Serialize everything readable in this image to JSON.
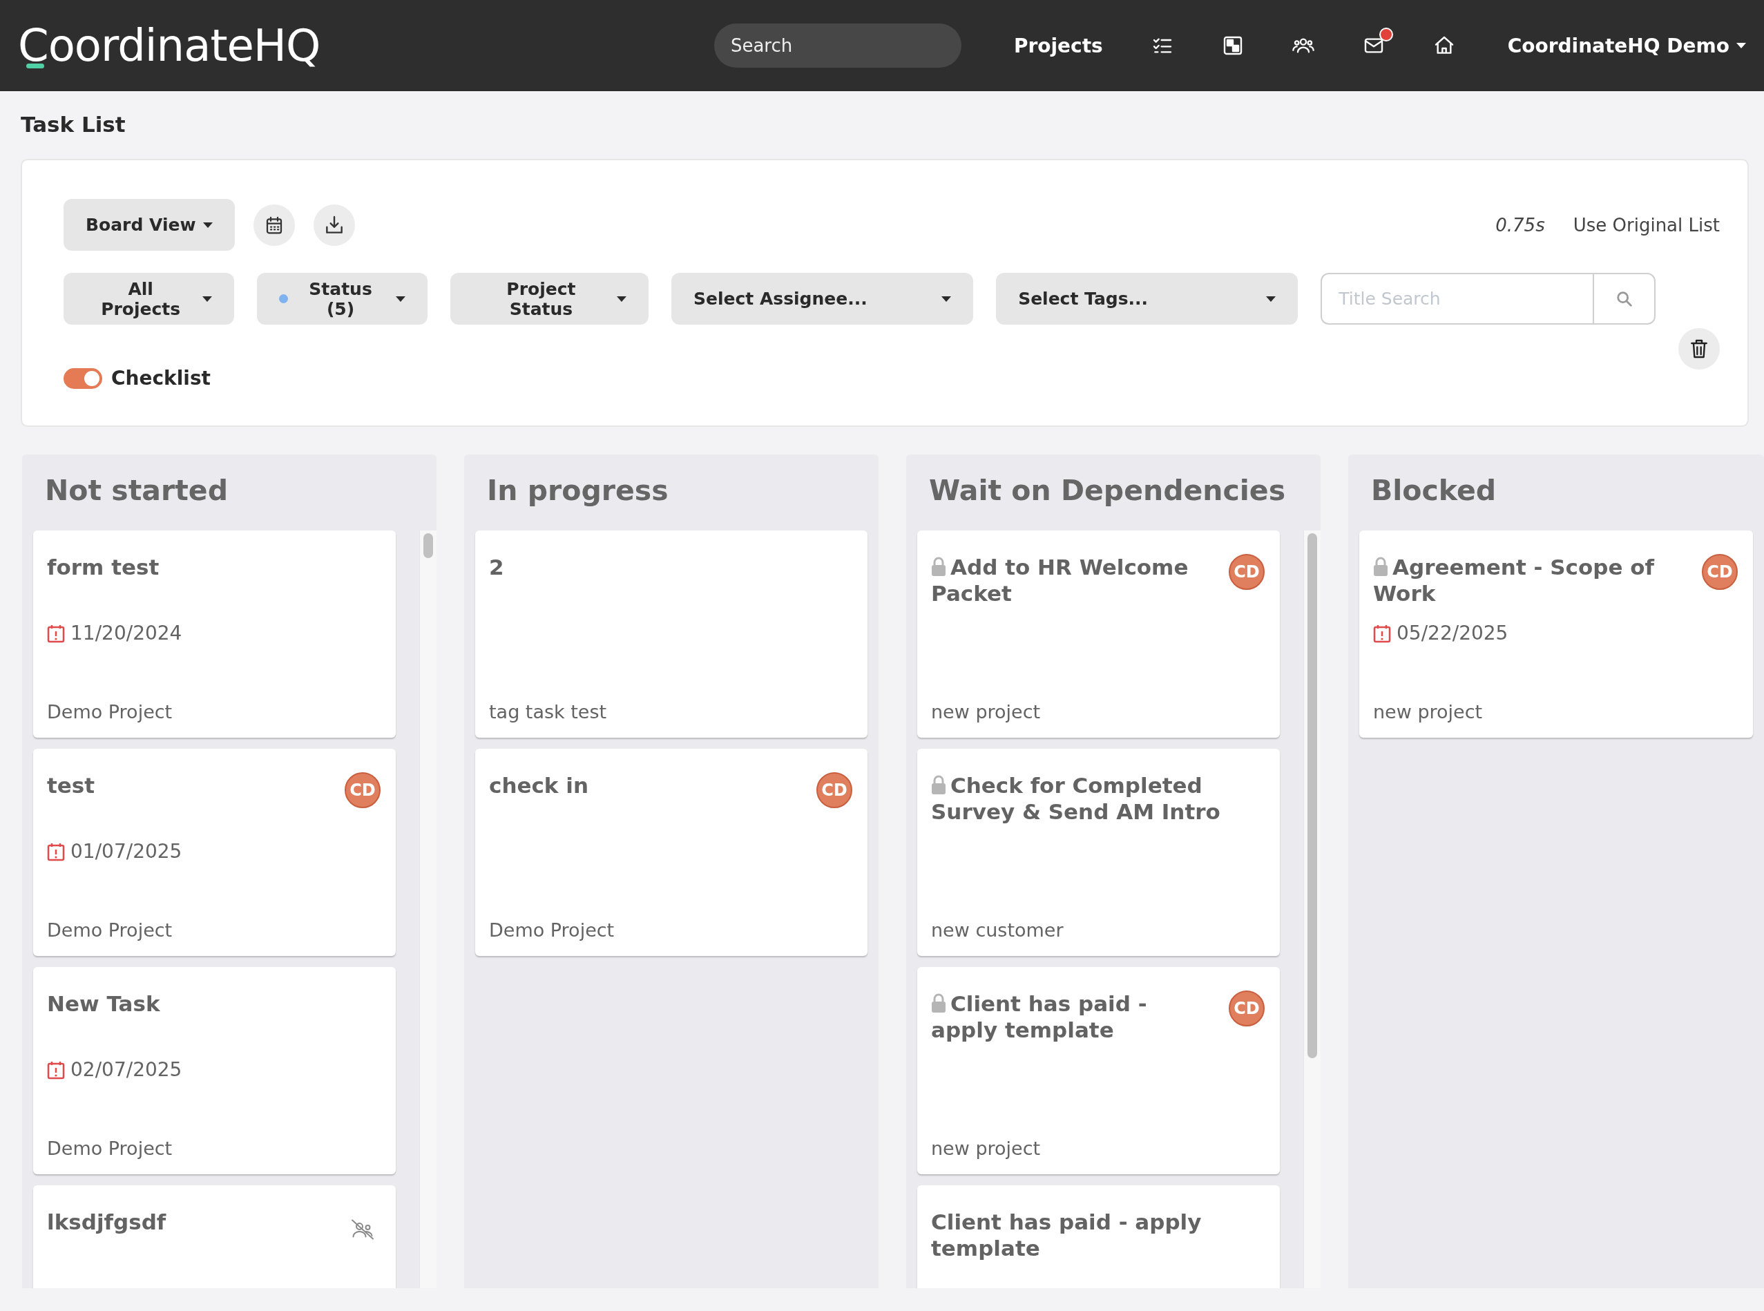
{
  "header": {
    "logo": "CoordinateHQ",
    "search": {
      "placeholder": "Search"
    },
    "nav_link": "Projects",
    "icons": [
      {
        "kind": "tasks"
      },
      {
        "kind": "board"
      },
      {
        "kind": "team"
      },
      {
        "kind": "mail",
        "badge": true
      },
      {
        "kind": "home"
      }
    ],
    "user_menu": "CoordinateHQ Demo"
  },
  "page_title": "Task List",
  "toolbar": {
    "view_button": "Board View",
    "timing": "0.75s",
    "link": "Use Original List",
    "filters": [
      {
        "label": "All Projects",
        "wide": false,
        "dot": false
      },
      {
        "label": "Status (5)",
        "wide": false,
        "dot": true
      },
      {
        "label": "Project Status",
        "wide": false,
        "dot": false
      },
      {
        "label": "Select Assignee...",
        "wide": true,
        "dot": false
      },
      {
        "label": "Select Tags...",
        "wide": true,
        "dot": false
      }
    ],
    "title_search": {
      "placeholder": "Title Search"
    },
    "checklist": {
      "label": "Checklist",
      "on": true
    }
  },
  "columns": [
    {
      "title": "Not started",
      "cards": [
        {
          "title": "form test",
          "locked": false,
          "date": "11/20/2024",
          "project": "Demo Project"
        },
        {
          "title": "test",
          "locked": false,
          "assignee": "CD",
          "date": "01/07/2025",
          "project": "Demo Project"
        },
        {
          "title": "New Task",
          "locked": false,
          "date": "02/07/2025",
          "project": "Demo Project"
        },
        {
          "title": "lksdjfgsdf",
          "locked": false,
          "unassigned": true
        }
      ]
    },
    {
      "title": "In progress",
      "cards": [
        {
          "title": "2",
          "locked": false,
          "project": "tag task test"
        },
        {
          "title": "check in",
          "locked": false,
          "assignee": "CD",
          "project": "Demo Project"
        }
      ]
    },
    {
      "title": "Wait on Dependencies",
      "cards": [
        {
          "title": "Add to HR Welcome Packet",
          "locked": true,
          "assignee": "CD",
          "project": "new project"
        },
        {
          "title": "Check for Completed Survey & Send AM Intro",
          "locked": true,
          "project": "new customer"
        },
        {
          "title": "Client has paid - apply template",
          "locked": true,
          "assignee": "CD",
          "project": "new project"
        },
        {
          "title": "Client has paid - apply template",
          "locked": false
        }
      ]
    },
    {
      "title": "Blocked",
      "cards": [
        {
          "title": "Agreement - Scope of Work",
          "locked": true,
          "assignee": "CD",
          "date": "05/22/2025",
          "project": "new project"
        }
      ]
    }
  ]
}
